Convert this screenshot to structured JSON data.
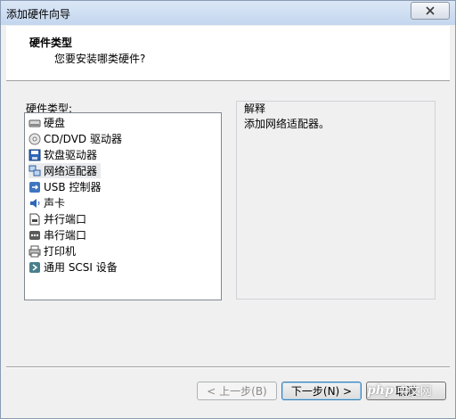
{
  "window": {
    "title": "添加硬件向导"
  },
  "header": {
    "title": "硬件类型",
    "subtitle": "您要安装哪类硬件?"
  },
  "list": {
    "label": "硬件类型:",
    "items": [
      {
        "label": "硬盘",
        "icon": "hard-disk-icon"
      },
      {
        "label": "CD/DVD 驱动器",
        "icon": "cd-dvd-icon"
      },
      {
        "label": "软盘驱动器",
        "icon": "floppy-icon"
      },
      {
        "label": "网络适配器",
        "icon": "network-adapter-icon",
        "selected": true
      },
      {
        "label": "USB 控制器",
        "icon": "usb-icon"
      },
      {
        "label": "声卡",
        "icon": "sound-card-icon"
      },
      {
        "label": "并行端口",
        "icon": "parallel-port-icon"
      },
      {
        "label": "串行端口",
        "icon": "serial-port-icon"
      },
      {
        "label": "打印机",
        "icon": "printer-icon"
      },
      {
        "label": "通用 SCSI 设备",
        "icon": "scsi-icon"
      }
    ]
  },
  "description": {
    "title": "解释",
    "text": "添加网络适配器。"
  },
  "buttons": {
    "back": "< 上一步(B)",
    "next": "下一步(N) >",
    "cancel": "取消"
  },
  "watermark": {
    "brand": "php",
    "text": "中文网"
  },
  "colors": {
    "selected_bg": "#e8eaed",
    "titlebar": "#c3d6ee",
    "default_border": "#3c7fb1"
  }
}
